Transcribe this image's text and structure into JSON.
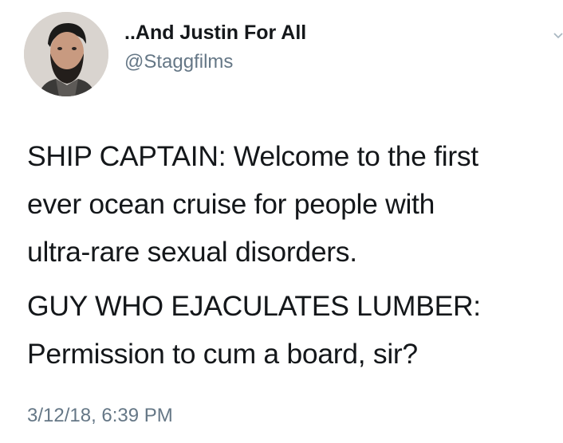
{
  "author": {
    "display_name": "..And Justin For All",
    "handle": "@Staggfilms",
    "avatar_icon": "profile-photo"
  },
  "tweet": {
    "paragraphs": [
      {
        "lines": [
          "SHIP CAPTAIN: Welcome to the first",
          "ever ocean cruise for people with",
          "ultra-rare sexual disorders."
        ]
      },
      {
        "lines": [
          "GUY WHO EJACULATES LUMBER:",
          "Permission to cum a board, sir?"
        ]
      }
    ],
    "timestamp": "3/12/18, 6:39 PM"
  },
  "menu": {
    "icon": "chevron-down-icon"
  },
  "colors": {
    "text": "#14171a",
    "secondary": "#657786",
    "background": "#ffffff"
  }
}
